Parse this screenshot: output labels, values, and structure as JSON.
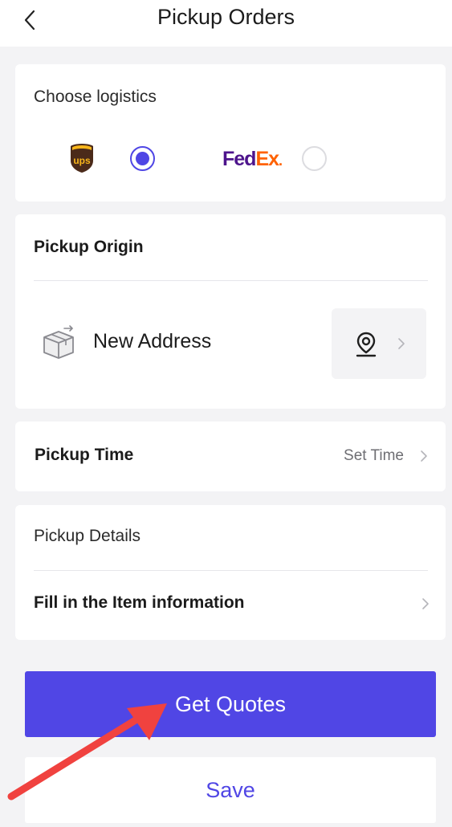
{
  "header": {
    "title": "Pickup Orders"
  },
  "logistics": {
    "label": "Choose logistics",
    "options": [
      {
        "carrier": "UPS",
        "logo_text": "ups",
        "selected": true
      },
      {
        "carrier": "FedEx",
        "logo_fed": "Fed",
        "logo_ex": "Ex",
        "logo_dot": ".",
        "selected": false
      }
    ]
  },
  "origin": {
    "label": "Pickup Origin",
    "address_label": "New Address"
  },
  "time": {
    "label": "Pickup Time",
    "action": "Set Time"
  },
  "details": {
    "label": "Pickup Details",
    "item_info": "Fill in the Item information"
  },
  "actions": {
    "get_quotes": "Get Quotes",
    "save": "Save"
  },
  "colors": {
    "accent": "#5046e5",
    "fedex_purple": "#4d148c",
    "fedex_orange": "#ff6200",
    "ups_brown": "#4b2a1a",
    "ups_gold": "#f9b61a",
    "annotation_arrow": "#f0423f"
  }
}
